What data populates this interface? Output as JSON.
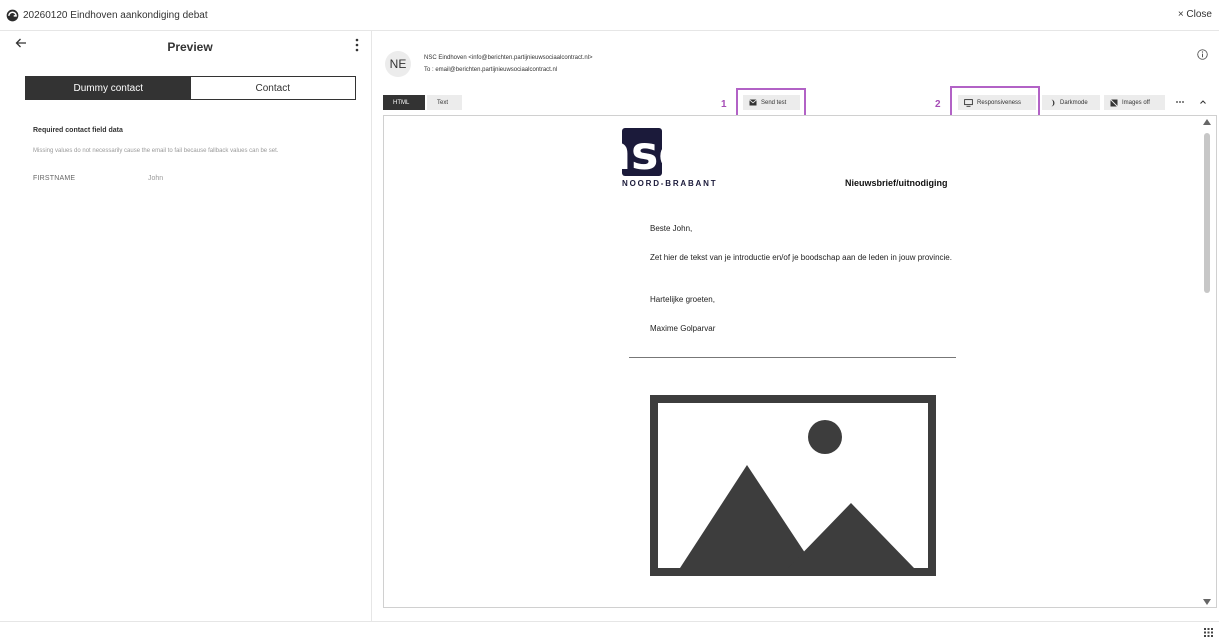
{
  "window": {
    "title": "20260120 Eindhoven aankondiging debat",
    "close_label": "× Close"
  },
  "left_panel": {
    "title": "Preview",
    "toggle": {
      "active": "Dummy contact",
      "inactive": "Contact"
    },
    "section_heading": "Required contact field data",
    "section_note": "Missing values do not necessarily cause the email to fail because fallback values can be set.",
    "fields": [
      {
        "name": "FIRSTNAME",
        "value": "John"
      }
    ]
  },
  "header": {
    "avatar_initials": "NE",
    "from": "NSC Eindhoven <info@berichten.partijnieuwsociaalcontract.nl>",
    "to": "To : email@berichten.partijnieuwsociaalcontract.nl"
  },
  "toolbar": {
    "tab_html": "HTML",
    "tab_text": "Text",
    "send_test": "Send test",
    "responsiveness": "Responsiveness",
    "darkmode": "Darkmode",
    "images_off": "Images off",
    "annotation_1": "1",
    "annotation_2": "2",
    "annotation_color": "#b262c6"
  },
  "email": {
    "logo_text": "nsc",
    "logo_sub": "NOORD-BRABANT",
    "newsletter_label": "Nieuwsbrief/uitnodiging",
    "greeting": "Beste John,",
    "body": "Zet hier de tekst van je introductie en/of je boodschap aan de leden in jouw provincie.",
    "closing": "Hartelijke groeten,",
    "signature": "Maxime Golparvar"
  },
  "colors": {
    "dark": "#333333",
    "brand_navy": "#1b1a3a",
    "button_bg": "#ececec"
  }
}
